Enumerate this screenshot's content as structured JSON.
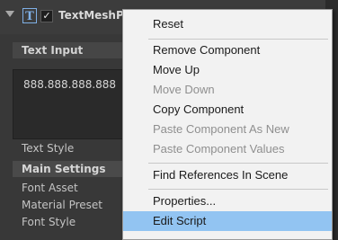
{
  "inspector": {
    "component_title": "TextMeshPro",
    "enabled_check": "✓",
    "text_icon_glyph": "T",
    "text_input_label": "Text Input",
    "text_value": "888.888.888.888",
    "text_style_label": "Text Style",
    "main_settings_label": "Main Settings",
    "font_asset_label": "Font Asset",
    "material_preset_label": "Material Preset",
    "font_style_label": "Font Style"
  },
  "context_menu": {
    "items": [
      {
        "label": "Reset",
        "enabled": true
      },
      {
        "label": "Remove Component",
        "enabled": true
      },
      {
        "label": "Move Up",
        "enabled": true
      },
      {
        "label": "Move Down",
        "enabled": false
      },
      {
        "label": "Copy Component",
        "enabled": true
      },
      {
        "label": "Paste Component As New",
        "enabled": false
      },
      {
        "label": "Paste Component Values",
        "enabled": false
      },
      {
        "label": "Find References In Scene",
        "enabled": true
      },
      {
        "label": "Properties...",
        "enabled": true
      },
      {
        "label": "Edit Script",
        "enabled": true,
        "highlighted": true
      }
    ]
  },
  "colors": {
    "menu_highlight": "#92c4f2",
    "disabled_text": "#8f8f8f",
    "inspector_bg": "#383838"
  }
}
